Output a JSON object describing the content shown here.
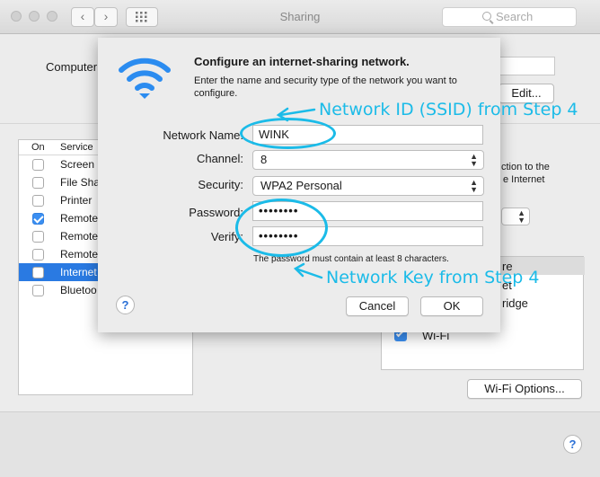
{
  "window": {
    "title": "Sharing",
    "back_glyph": "‹",
    "forward_glyph": "›",
    "search_placeholder": "Search"
  },
  "background": {
    "computer_name_label": "Computer",
    "edit_button": "Edit...",
    "services_header": {
      "on": "On",
      "service": "Service"
    },
    "services": [
      {
        "name": "Screen",
        "checked": false,
        "selected": false
      },
      {
        "name": "File Sha",
        "checked": false,
        "selected": false
      },
      {
        "name": "Printer",
        "checked": false,
        "selected": false
      },
      {
        "name": "Remote",
        "checked": true,
        "selected": false
      },
      {
        "name": "Remote",
        "checked": false,
        "selected": false
      },
      {
        "name": "Remote",
        "checked": false,
        "selected": false
      },
      {
        "name": "Internet",
        "checked": false,
        "selected": true
      },
      {
        "name": "Bluetoo",
        "checked": false,
        "selected": false
      }
    ],
    "right_text_line1": "ction to the",
    "right_text_line2": "e Internet",
    "right_item_1": "re",
    "right_item_2": "et",
    "right_item_3": "ridge",
    "right_item_wifi": "Wi-Fi",
    "wifi_options_button": "Wi-Fi Options...",
    "help_glyph": "?"
  },
  "sheet": {
    "title": "Configure an internet-sharing network.",
    "description": "Enter the name and security type of the network you want to configure.",
    "network_name_label": "Network Name:",
    "network_name_value": "WINK",
    "channel_label": "Channel:",
    "channel_value": "8",
    "security_label": "Security:",
    "security_value": "WPA2 Personal",
    "password_label": "Password:",
    "password_value": "••••••••",
    "verify_label": "Verify:",
    "verify_value": "••••••••",
    "hint": "The password must contain at least 8 characters.",
    "cancel_button": "Cancel",
    "ok_button": "OK",
    "help_glyph": "?"
  },
  "annotations": {
    "ssid_note": "Network ID (SSID) from Step 4",
    "key_note": "Network Key from Step 4",
    "color": "#1bbbe8"
  },
  "colors": {
    "selection": "#2a7ae2",
    "checkbox_checked": "#3b8ff2",
    "wifi_icon": "#2b8cf0"
  }
}
